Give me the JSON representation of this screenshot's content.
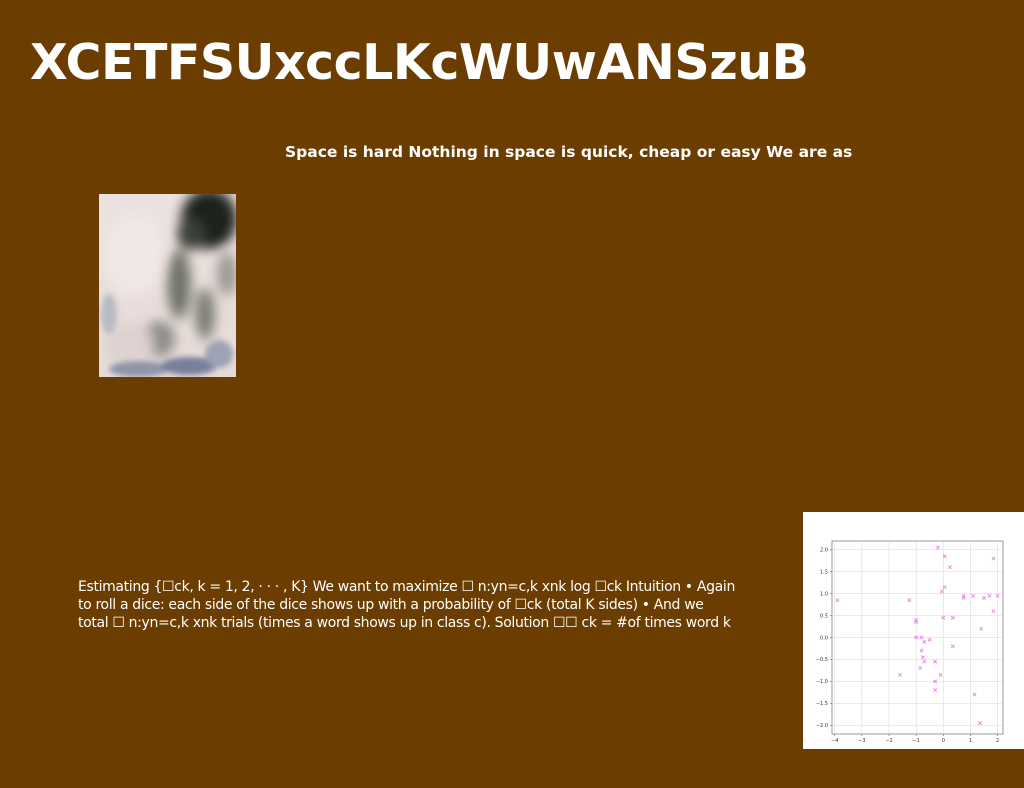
{
  "slide": {
    "title": "XCETFSUxccLKcWUwANSzuB",
    "subtitle": "Space is hard Nothing in space is quick, cheap or easy We are as",
    "body_lines": [
      "Estimating {☐ck, k = 1, 2, · · · , K} We want to maximize ☐ n:yn=c,k xnk log ☐ck Intuition • Again",
      "to roll a dice: each side of the dice shows up with a probability of ☐ck (total K sides) • And we",
      "total ☐ n:yn=c,k xnk trials (times a word shows up in class c). Solution ☐☐ ck = #of times word k"
    ],
    "background_color": "#6b3d00",
    "text_color": "#ffffff"
  },
  "chart_data": {
    "type": "scatter",
    "marker": "x",
    "marker_color": "#e27be2",
    "grid": true,
    "xlim": [
      -4.1,
      2.2
    ],
    "ylim": [
      -2.2,
      2.2
    ],
    "x_ticks": [
      -4,
      -3,
      -2,
      -1,
      0,
      1,
      2
    ],
    "x_tick_labels": [
      "−4",
      "−3",
      "−2",
      "−1",
      "0",
      "1",
      "2"
    ],
    "y_ticks": [
      2.0,
      1.5,
      1.0,
      0.5,
      0.0,
      -0.5,
      -1.0,
      -1.5,
      -2.0
    ],
    "y_tick_labels": [
      "2.0",
      "1.5",
      "1.0",
      "0.5",
      "0.0",
      "−0.5",
      "−1.0",
      "−1.5",
      "−2.0"
    ],
    "points": [
      [
        -3.9,
        0.85
      ],
      [
        -1.25,
        0.85
      ],
      [
        -1.0,
        0.4
      ],
      [
        -1.0,
        0.35
      ],
      [
        -1.0,
        0.0
      ],
      [
        -0.8,
        0.0
      ],
      [
        -0.7,
        -0.1
      ],
      [
        -0.5,
        -0.05
      ],
      [
        -0.8,
        -0.3
      ],
      [
        -0.75,
        -0.45
      ],
      [
        -0.7,
        -0.55
      ],
      [
        -0.85,
        -0.7
      ],
      [
        -0.3,
        -0.55
      ],
      [
        -0.3,
        -1.0
      ],
      [
        -0.3,
        -1.2
      ],
      [
        -0.1,
        -0.85
      ],
      [
        -1.6,
        -0.85
      ],
      [
        -0.2,
        2.05
      ],
      [
        0.05,
        1.85
      ],
      [
        0.25,
        1.6
      ],
      [
        0.05,
        1.15
      ],
      [
        -0.05,
        1.05
      ],
      [
        0.0,
        0.45
      ],
      [
        0.35,
        0.45
      ],
      [
        0.35,
        -0.2
      ],
      [
        0.75,
        0.95
      ],
      [
        0.75,
        0.9
      ],
      [
        1.1,
        0.95
      ],
      [
        1.5,
        0.9
      ],
      [
        1.7,
        0.95
      ],
      [
        2.0,
        0.95
      ],
      [
        1.85,
        1.8
      ],
      [
        1.85,
        0.6
      ],
      [
        1.4,
        0.2
      ],
      [
        1.15,
        -1.3
      ],
      [
        1.35,
        -1.95
      ]
    ]
  }
}
